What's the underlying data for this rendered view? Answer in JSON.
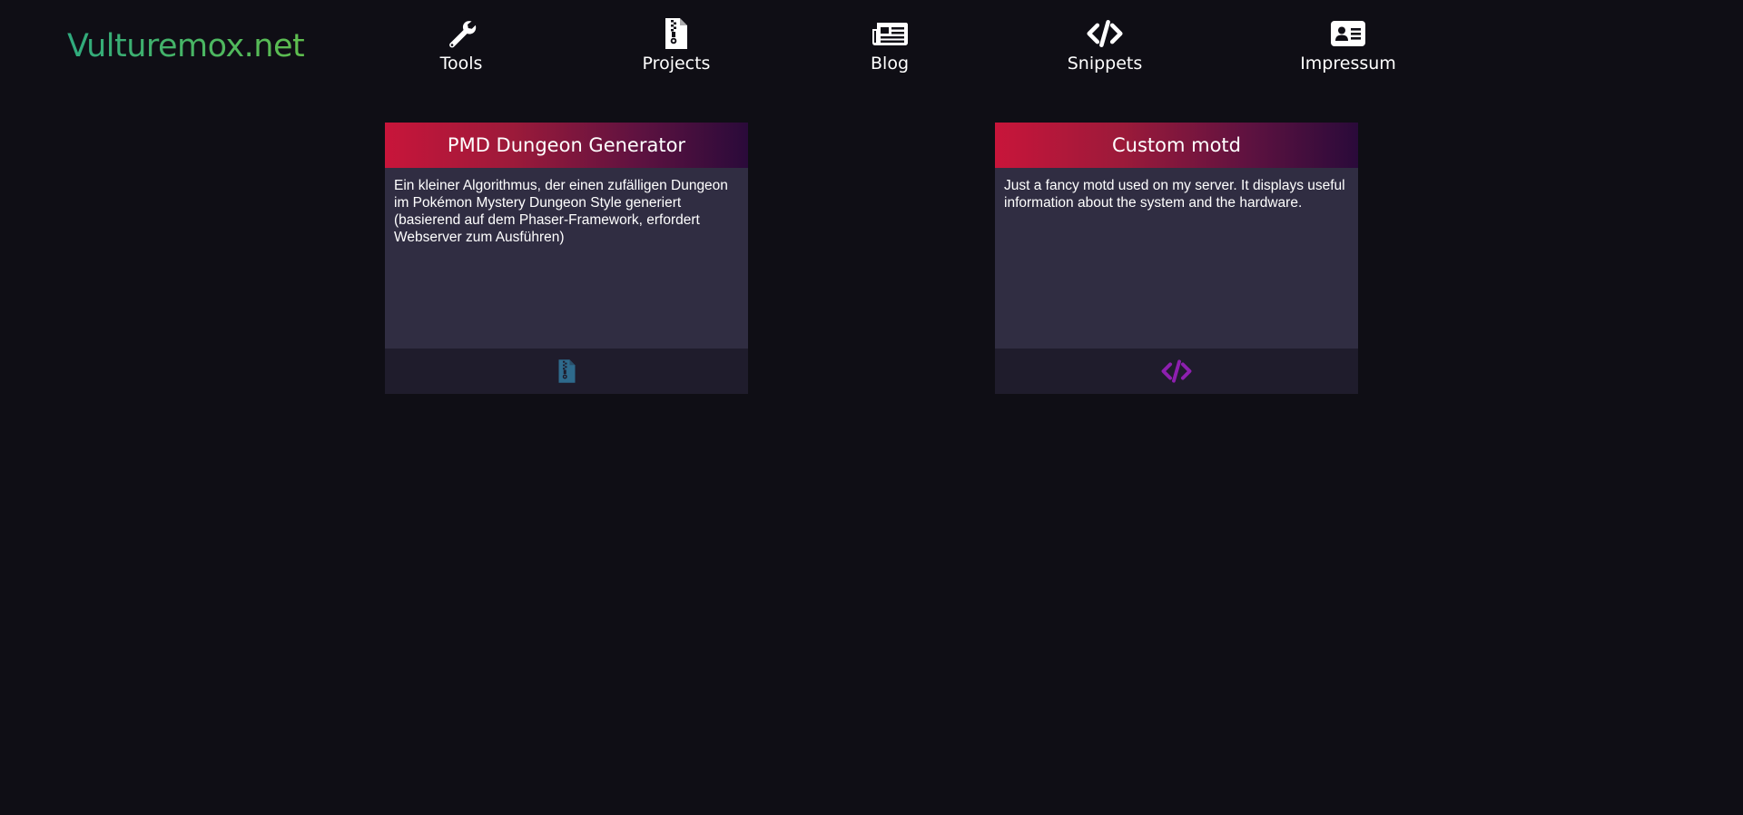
{
  "site": {
    "logo": "Vulturemox.net"
  },
  "nav": {
    "tools": {
      "label": "Tools",
      "icon": "wrench-icon"
    },
    "projects": {
      "label": "Projects",
      "icon": "file-archive-icon"
    },
    "blog": {
      "label": "Blog",
      "icon": "newspaper-icon"
    },
    "snippets": {
      "label": "Snippets",
      "icon": "code-icon"
    },
    "impressum": {
      "label": "Impressum",
      "icon": "address-card-icon"
    }
  },
  "cards": [
    {
      "title": "PMD Dungeon Generator",
      "description": "Ein kleiner Algorithmus, der einen zufälligen Dungeon im Pokémon Mystery Dungeon Style generiert (basierend auf dem Phaser-Framework, erfordert Webserver zum Ausführen)",
      "footer_icon": "file-archive-icon",
      "footer_icon_color": "#2e6a8c"
    },
    {
      "title": "Custom motd",
      "description": "Just a fancy motd used on my server. It displays useful information about the system and the hardware.",
      "footer_icon": "code-icon",
      "footer_icon_color": "#8e1fb0"
    }
  ],
  "colors": {
    "background": "#0f0e15",
    "logo_gradient_start": "#2faa7e",
    "logo_gradient_end": "#5fbe4e",
    "card_header_start": "#c8153a",
    "card_header_end": "#2a0a3a",
    "card_body": "#302d42",
    "card_footer": "#1f1c2c"
  }
}
